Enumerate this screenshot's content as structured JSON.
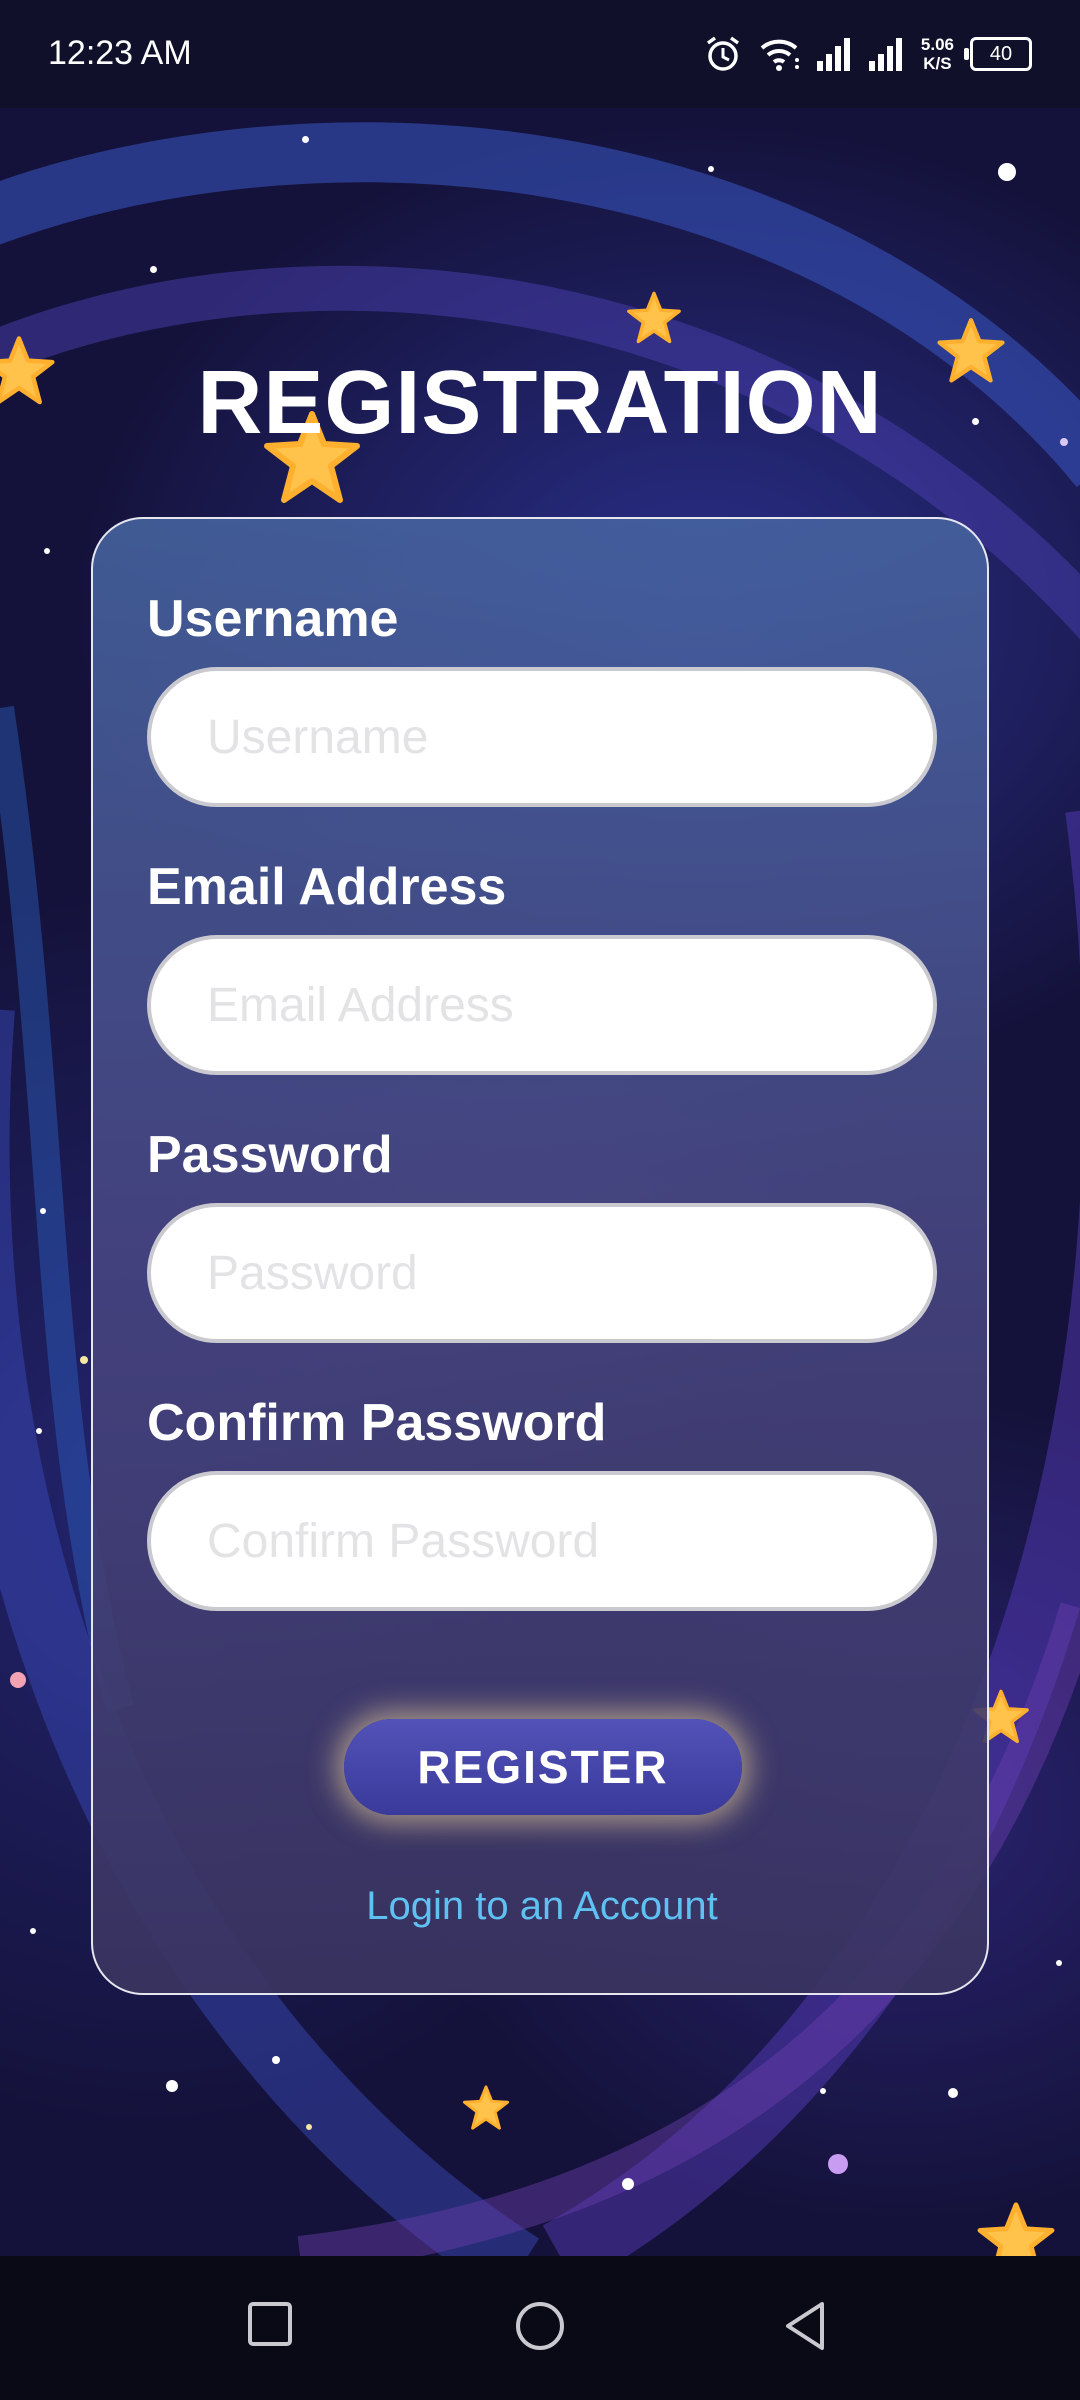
{
  "status_bar": {
    "time": "12:23 AM",
    "speed_value": "5.06",
    "speed_unit": "K/S",
    "battery": "40",
    "icons": [
      "alarm-icon",
      "wifi-icon",
      "signal-icon",
      "signal-icon"
    ]
  },
  "page": {
    "title": "REGISTRATION"
  },
  "form": {
    "username": {
      "label": "Username",
      "placeholder": "Username",
      "value": ""
    },
    "email": {
      "label": "Email Address",
      "placeholder": "Email Address",
      "value": ""
    },
    "password": {
      "label": "Password",
      "placeholder": "Password",
      "value": ""
    },
    "confirm_password": {
      "label": "Confirm Password",
      "placeholder": "Confirm Password",
      "value": ""
    },
    "register_label": "REGISTER",
    "login_link": "Login to an Account"
  },
  "colors": {
    "accent_button": "#4545a8",
    "link": "#5fc0f2",
    "background": "#14123a"
  },
  "nav_bar": {
    "icons": [
      "recent-apps-icon",
      "home-icon",
      "back-icon"
    ]
  }
}
